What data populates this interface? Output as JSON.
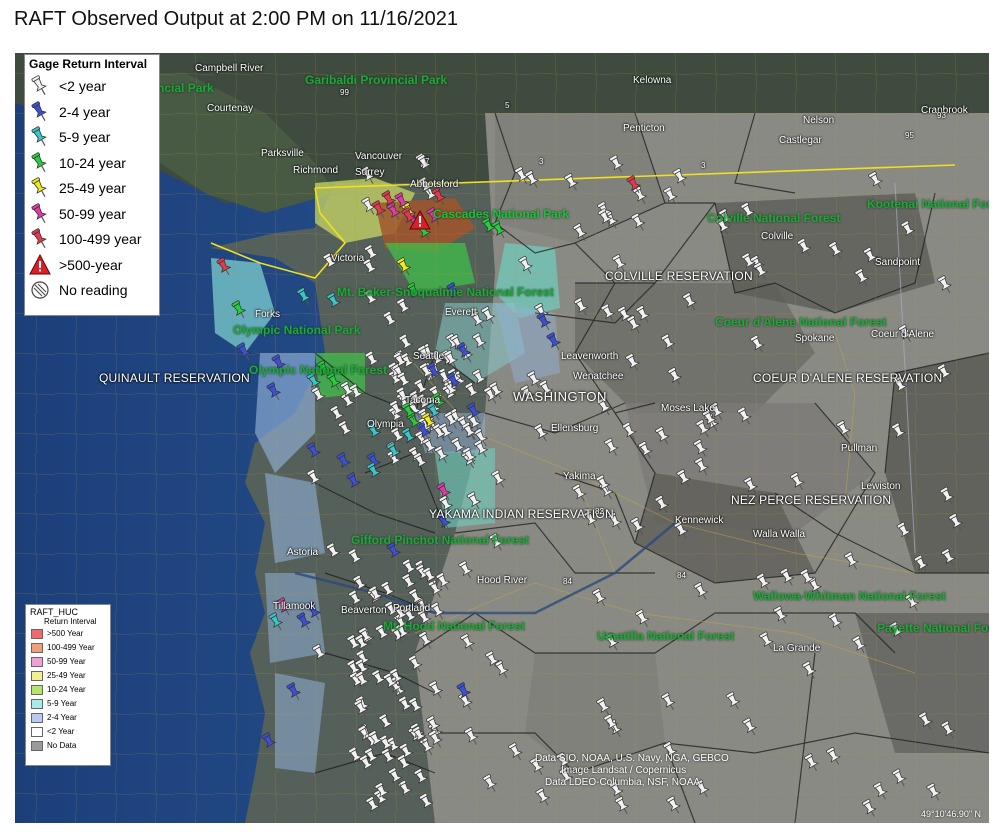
{
  "title": "RAFT Observed Output at 2:00 PM on 11/16/2021",
  "legend_gage": {
    "title": "Gage Return Interval",
    "items": [
      {
        "label": "<2 year",
        "color": "#f2f2f2",
        "icon": "pushpin-icon"
      },
      {
        "label": "2-4 year",
        "color": "#3b4fd8",
        "icon": "pushpin-icon"
      },
      {
        "label": "5-9 year",
        "color": "#39c6c6",
        "icon": "pushpin-icon"
      },
      {
        "label": "10-24 year",
        "color": "#22d13a",
        "icon": "pushpin-icon"
      },
      {
        "label": "25-49 year",
        "color": "#f3e81b",
        "icon": "pushpin-icon"
      },
      {
        "label": "50-99 year",
        "color": "#e23aa8",
        "icon": "pushpin-icon"
      },
      {
        "label": "100-499 year",
        "color": "#e8374d",
        "icon": "pushpin-icon"
      },
      {
        "label": ">500-year",
        "color": "#d8202a",
        "icon": "warning-triangle-icon"
      },
      {
        "label": "No reading",
        "color": "#777777",
        "icon": "hatched-circle-icon"
      }
    ]
  },
  "legend_huc": {
    "title": "RAFT_HUC",
    "subtitle": "Return Interval",
    "items": [
      {
        "label": ">500 Year",
        "color": "#f06a6a"
      },
      {
        "label": "100-499 Year",
        "color": "#f0a07a"
      },
      {
        "label": "50-99 Year",
        "color": "#f0a0d8"
      },
      {
        "label": "25-49 Year",
        "color": "#f3f090"
      },
      {
        "label": "10-24 Year",
        "color": "#b6e36a"
      },
      {
        "label": "5-9 Year",
        "color": "#a6eaea"
      },
      {
        "label": "2-4 Year",
        "color": "#b8cbef"
      },
      {
        "label": "<2 Year",
        "color": "#ffffff"
      },
      {
        "label": "No Data",
        "color": "#9a9a9a"
      }
    ]
  },
  "places": {
    "cities": [
      "Campbell River",
      "Courtenay",
      "Parksville",
      "Vancouver",
      "Richmond",
      "Surrey",
      "Abbotsford",
      "Victoria",
      "Forks",
      "Everett",
      "Seattle",
      "Tacoma",
      "Olympia",
      "Leavenworth",
      "Wenatchee",
      "Moses Lake",
      "Ellensburg",
      "Yakima",
      "Kennewick",
      "Walla Walla",
      "Astoria",
      "Beaverton",
      "Portland",
      "Hood River",
      "Kelowna",
      "Penticton",
      "Nelson",
      "Castlegar",
      "Cranbrook",
      "Colville",
      "Sandpoint",
      "Spokane",
      "Coeur d'Alene",
      "Pullman",
      "Lewiston",
      "La Grande",
      "Tillamook"
    ],
    "forests": [
      "Garibaldi Provincial Park",
      "Strathcona Provincial Park",
      "Cascades National Park",
      "Colville National Forest",
      "Kootenai National Forest",
      "Mt. Baker-Snoqualmie National Forest",
      "Olympic National Park",
      "Olympic National Forest",
      "Coeur d'Alene National Forest",
      "Gifford Pinchot National Forest",
      "Mt. Hood National Forest",
      "Wallowa-Whitman National Forest",
      "Umatilla National Forest",
      "Payette National Forest"
    ],
    "reservations": [
      "COLVILLE RESERVATION",
      "QUINAULT RESERVATION",
      "COEUR D'ALENE RESERVATION",
      "NEZ PERCE RESERVATION",
      "YAKAMA INDIAN RESERVATION"
    ],
    "state": "WASHINGTON"
  },
  "labels_display": {
    "campbell": "Campbell River",
    "strathcona": "rovincial Park",
    "courtenay": "Courtenay",
    "parksville": "Parksville",
    "garibaldi": "Garibaldi Provincial Park",
    "vancouver": "Vancouver",
    "richmond": "Richmond",
    "surrey": "Surrey",
    "abbotsford": "Abbotsford",
    "victoria": "Victoria",
    "cascades": "Cascades National Park",
    "mtbaker": "Mt. Baker-Snoqualmie National Forest",
    "olympic_np": "Olympic National Park",
    "olympic_nf": "Olympic National Forest",
    "forks": "Forks",
    "everett": "Everett",
    "seattle": "Seattle",
    "tacoma": "Tacoma",
    "olympia": "Olympia",
    "quinault": "QUINAULT RESERVATION",
    "leavenworth": "Leavenworth",
    "wenatchee": "Wenatchee",
    "washington": "WASHINGTON",
    "moses": "Moses Lake",
    "ellensburg": "Ellensburg",
    "yakima": "Yakima",
    "yakama": "YAKAMA INDIAN RESERVATION",
    "gifford": "Gifford Pinchot National Forest",
    "kennewick": "Kennewick",
    "walla": "Walla Walla",
    "astoria": "Astoria",
    "hood": "Hood River",
    "beaverton": "Beaverton",
    "portland": "Portland",
    "mthood": "Mt. Hood National Forest",
    "tillamook": "Tillamook",
    "kelowna": "Kelowna",
    "penticton": "Penticton",
    "nelson": "Nelson",
    "castlegar": "Castlegar",
    "cranbrook": "Cranbrook",
    "colville_nf": "Colville National Forest",
    "kootenai": "Kootenai National Forest",
    "colville": "Colville",
    "colville_res": "COLVILLE RESERVATION",
    "sandpoint": "Sandpoint",
    "coeur_nf": "Coeur d'Alene National Forest",
    "spokane": "Spokane",
    "coeur_city": "Coeur d'Alene",
    "coeur_res": "COEUR D'ALENE RESERVATION",
    "pullman": "Pullman",
    "lewiston": "Lewiston",
    "nezperce": "NEZ PERCE RESERVATION",
    "wallowa": "Wallowa-Whitman National Forest",
    "lagrande": "La Grande",
    "umatilla": "Umatilla National Forest",
    "payette": "Payette National Fore",
    "hwy_99": "99",
    "hwy_5": "5",
    "hwy_3a": "3",
    "hwy_3b": "3",
    "hwy_7": "7",
    "hwy_95": "95",
    "hwy_93": "93",
    "hwy_82": "82",
    "hwy_84a": "84",
    "hwy_84b": "84"
  },
  "attribution": {
    "line1": "Data SIO, NOAA, U.S. Navy, NGA, GEBCO",
    "line2": "Image Landsat / Copernicus",
    "line3": "Data LDEO-Columbia, NSF, NOAA"
  },
  "coordinates": "49°10'46.90\" N",
  "colors": {
    "ocean": "#234f8a",
    "land_dark": "#3d4a45",
    "basin_gray": "#8b8b87",
    "basin_dark": "#5c5c58",
    "border_yellow": "#f0e020",
    "alert_red": "#d8202a"
  },
  "map_icons": [
    "pushpin-icon",
    "warning-triangle-icon",
    "highway-shield-icon"
  ]
}
